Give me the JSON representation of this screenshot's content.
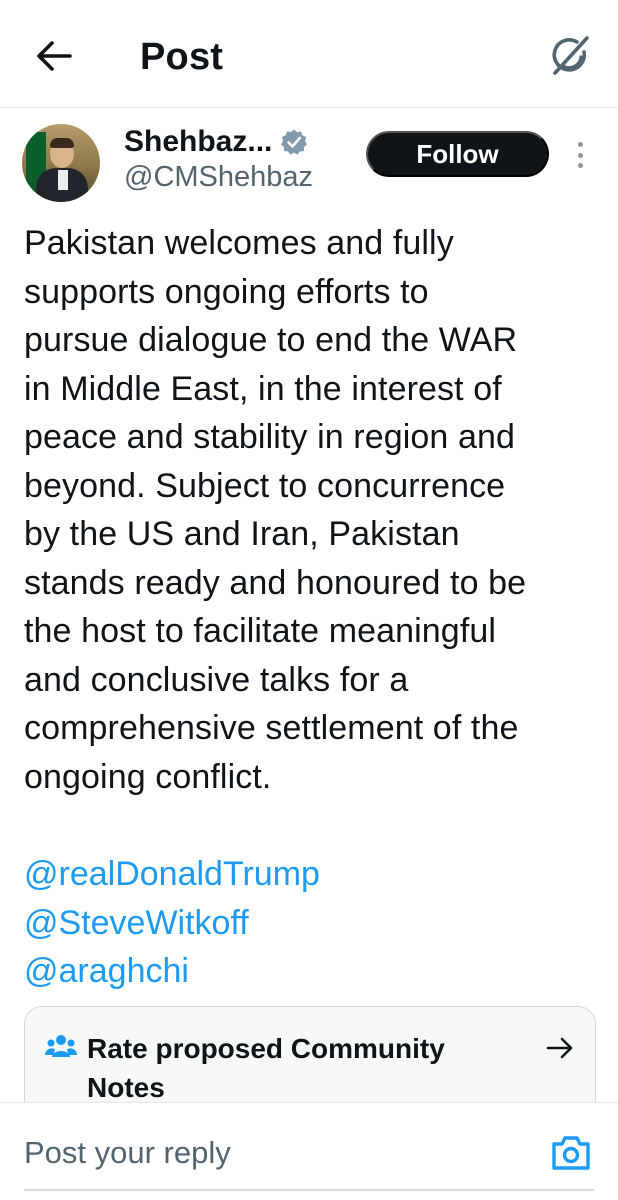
{
  "header": {
    "back_icon": "arrow-left-icon",
    "title": "Post",
    "grok_icon": "grok-icon"
  },
  "author": {
    "name": "Shehbaz...",
    "handle": "@CMShehbaz",
    "verified_icon": "verified-badge-icon",
    "follow_label": "Follow",
    "more_icon": "more-vertical-icon"
  },
  "post": {
    "text": "Pakistan welcomes and fully\nsupports ongoing efforts to\npursue dialogue to end the WAR\nin Middle East, in the interest of\npeace and stability in region and\nbeyond. Subject to concurrence\nby the US and Iran, Pakistan\nstands ready and honoured to be\nthe host to facilitate meaningful\nand conclusive talks for a\ncomprehensive settlement of the\nongoing conflict.",
    "mentions": [
      "@realDonaldTrump",
      "@SteveWitkoff",
      "@araghchi"
    ]
  },
  "community_notes": {
    "icon": "people-icon",
    "label": "Rate proposed Community Notes",
    "arrow_icon": "arrow-right-icon"
  },
  "reply": {
    "placeholder": "Post your reply",
    "camera_icon": "camera-icon"
  },
  "colors": {
    "link": "#1d9bf0",
    "text": "#0f1419",
    "secondary_text": "#536471",
    "follow_bg": "#0f1419"
  }
}
